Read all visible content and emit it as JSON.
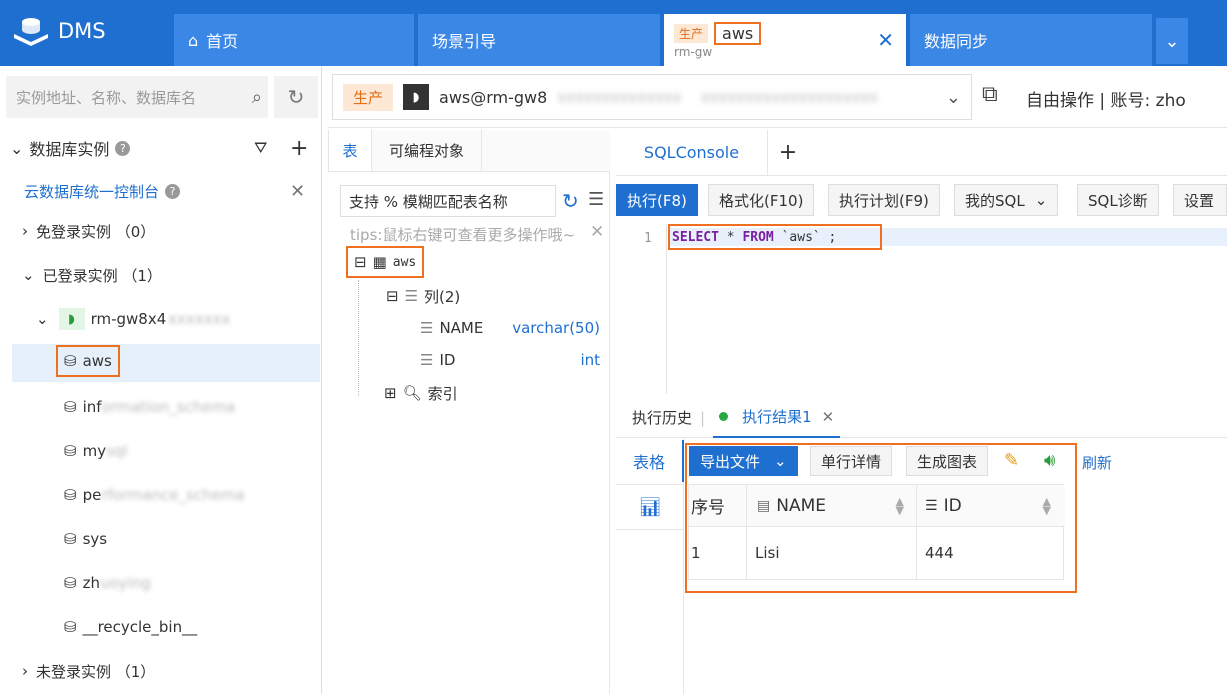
{
  "app": {
    "brand": "DMS"
  },
  "tabs": [
    {
      "label": "首页"
    },
    {
      "label": "场景引导"
    },
    {
      "env": "生产",
      "label": "aws",
      "sub": "rm-gw"
    },
    {
      "label": "数据同步"
    }
  ],
  "sidebar": {
    "search_placeholder": "实例地址、名称、数据库名",
    "section_title": "数据库实例",
    "console_link": "云数据库统一控制台",
    "groups": {
      "free_login": "免登录实例 （0）",
      "logged_in": "已登录实例 （1）",
      "not_logged": "未登录实例 （1）"
    },
    "instance": "rm-gw8x4",
    "databases": [
      "aws",
      "inf",
      "my",
      "pe",
      "sys",
      "zh",
      "__recycle_bin__"
    ]
  },
  "toolbar": {
    "env": "生产",
    "connection": "aws@rm-gw8",
    "mode": "自由操作 | 账号: zho"
  },
  "objects": {
    "tab_table": "表",
    "tab_programmable": "可编程对象",
    "filter_placeholder": "支持 % 模糊匹配表名称",
    "tips": "tips:鼠标右键可查看更多操作哦~",
    "table_name": "aws",
    "columns_label": "列(2)",
    "columns": [
      {
        "name": "NAME",
        "type": "varchar(50)"
      },
      {
        "name": "ID",
        "type": "int"
      }
    ],
    "index_label": "索引"
  },
  "editor": {
    "tab": "SQLConsole",
    "add": "+",
    "buttons": {
      "run": "执行(F8)",
      "format": "格式化(F10)",
      "plan": "执行计划(F9)",
      "mysql": "我的SQL",
      "diagnose": "SQL诊断",
      "settings": "设置"
    },
    "line_no": "1",
    "sql": {
      "kw1": "SELECT",
      "star": " * ",
      "kw2": "FROM",
      "rest": " `aws` ;"
    }
  },
  "results": {
    "tab_history": "执行历史",
    "tab_result": "执行结果1",
    "side_table": "表格",
    "export": "导出文件",
    "single_row": "单行详情",
    "chart": "生成图表",
    "refresh": "刷新",
    "headers": [
      "序号",
      "NAME",
      "ID"
    ],
    "rows": [
      [
        "1",
        "Lisi",
        "444"
      ]
    ]
  }
}
